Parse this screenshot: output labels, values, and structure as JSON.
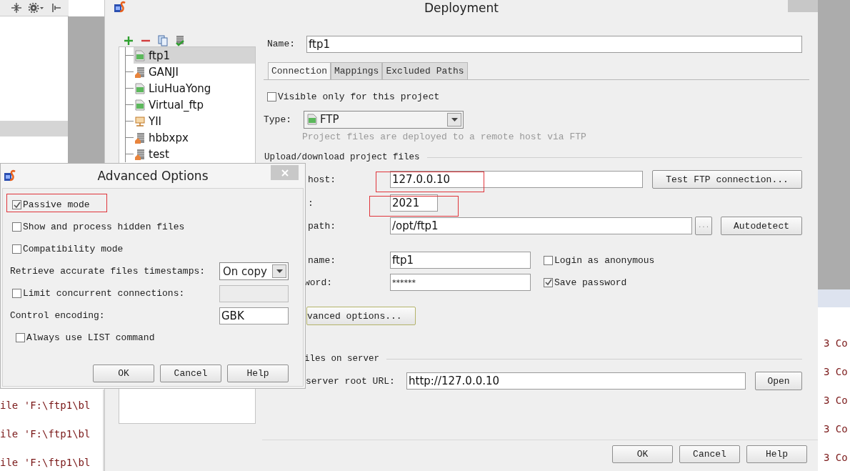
{
  "ide_panel": {
    "console_lines": [
      "ile 'F:\\ftp1\\bl",
      "ile 'F:\\ftp1\\bl",
      "ile 'F:\\ftp1\\bl"
    ]
  },
  "background_console": {
    "lines": [
      "3 Co",
      "3 Co",
      "3 Co",
      "3 Co",
      "3 Co"
    ]
  },
  "deployment": {
    "title": "Deployment",
    "servers": [
      {
        "name": "ftp1",
        "kind": "ftp",
        "selected": true
      },
      {
        "name": "GANJI",
        "kind": "server",
        "selected": false
      },
      {
        "name": "LiuHuaYong",
        "kind": "ftp",
        "selected": false
      },
      {
        "name": "Virtual_ftp",
        "kind": "ftp",
        "selected": false
      },
      {
        "name": "YII",
        "kind": "network",
        "selected": false
      },
      {
        "name": "hbbxpx",
        "kind": "server",
        "selected": false
      },
      {
        "name": "test",
        "kind": "server",
        "selected": false
      }
    ],
    "name": {
      "label": "Name:",
      "value": "ftp1"
    },
    "tabs": [
      {
        "label": "Connection",
        "selected": true
      },
      {
        "label": "Mappings",
        "selected": false
      },
      {
        "label": "Excluded Paths",
        "selected": false
      }
    ],
    "visible_only": {
      "label": "Visible only for this project",
      "checked": false
    },
    "type": {
      "label": "Type:",
      "value": "FTP",
      "hint": "Project files are deployed to a remote host via FTP"
    },
    "upload_section": "Upload/download project files",
    "host": {
      "label": "host:",
      "value": "127.0.0.10",
      "highlighted": true,
      "button": "Test FTP connection..."
    },
    "port": {
      "label": ":",
      "value": "2021",
      "highlighted": true
    },
    "root_path": {
      "label": "path:",
      "value": "/opt/ftp1",
      "browse": "...",
      "button": "Autodetect"
    },
    "user": {
      "label": "name:",
      "value": "ftp1",
      "option": {
        "label": "Login as anonymous",
        "checked": false
      }
    },
    "password": {
      "label": "word:",
      "value": "******",
      "option": {
        "label": "Save password",
        "checked": true
      }
    },
    "advanced_button": "vanced options...",
    "browse_section": "iles on server",
    "web_url": {
      "label": "server root URL:",
      "value": "http://127.0.0.10",
      "button": "Open"
    },
    "buttons": [
      "OK",
      "Cancel",
      "Help"
    ]
  },
  "advanced_options": {
    "title": "Advanced Options",
    "options": [
      {
        "kind": "checkbox",
        "label": "Passive mode",
        "checked": true,
        "highlighted": true
      },
      {
        "kind": "checkbox",
        "label": "Show and process hidden files",
        "checked": false,
        "highlighted": false
      },
      {
        "kind": "checkbox",
        "label": "Compatibility mode",
        "checked": false,
        "highlighted": false
      },
      {
        "kind": "select",
        "label": "Retrieve accurate files timestamps:",
        "value": "On copy"
      },
      {
        "kind": "checkbox-input",
        "label": "Limit concurrent connections:",
        "checked": false,
        "disabled": true
      },
      {
        "kind": "text",
        "label": "Control encoding:",
        "value": "GBK"
      },
      {
        "kind": "checkbox-indented",
        "label": "Always use LIST command",
        "checked": false,
        "highlighted": false
      }
    ],
    "buttons": [
      "OK",
      "Cancel",
      "Help"
    ]
  }
}
